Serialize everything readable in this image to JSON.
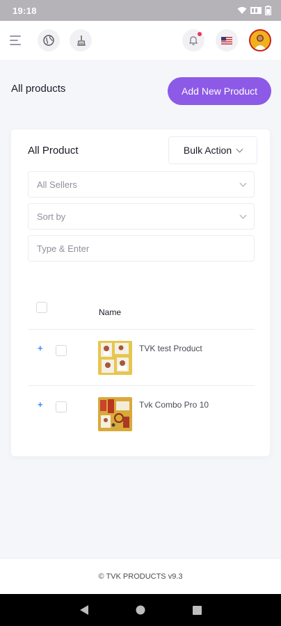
{
  "status_bar": {
    "time": "19:18",
    "icons": [
      "wifi-icon",
      "signal-icon",
      "battery-icon"
    ]
  },
  "header": {
    "icons": [
      "menu-icon",
      "globe-icon",
      "broom-icon",
      "bell-icon",
      "us-flag-icon",
      "avatar"
    ],
    "notification_dot_color": "#e8385a"
  },
  "page": {
    "title": "All products",
    "add_button_label": "Add New Product",
    "accent_color": "#8c5ae6"
  },
  "card": {
    "title": "All Product",
    "bulk_action_label": "Bulk Action",
    "filters": {
      "sellers_selected": "All Sellers",
      "sort_selected": "Sort by",
      "search_placeholder": "Type & Enter"
    },
    "table": {
      "columns": [
        "Name"
      ],
      "rows": [
        {
          "name": "TVK test Product"
        },
        {
          "name": "Tvk Combo Pro 10"
        }
      ]
    }
  },
  "footer": {
    "text": "© TVK PRODUCTS v9.3"
  }
}
